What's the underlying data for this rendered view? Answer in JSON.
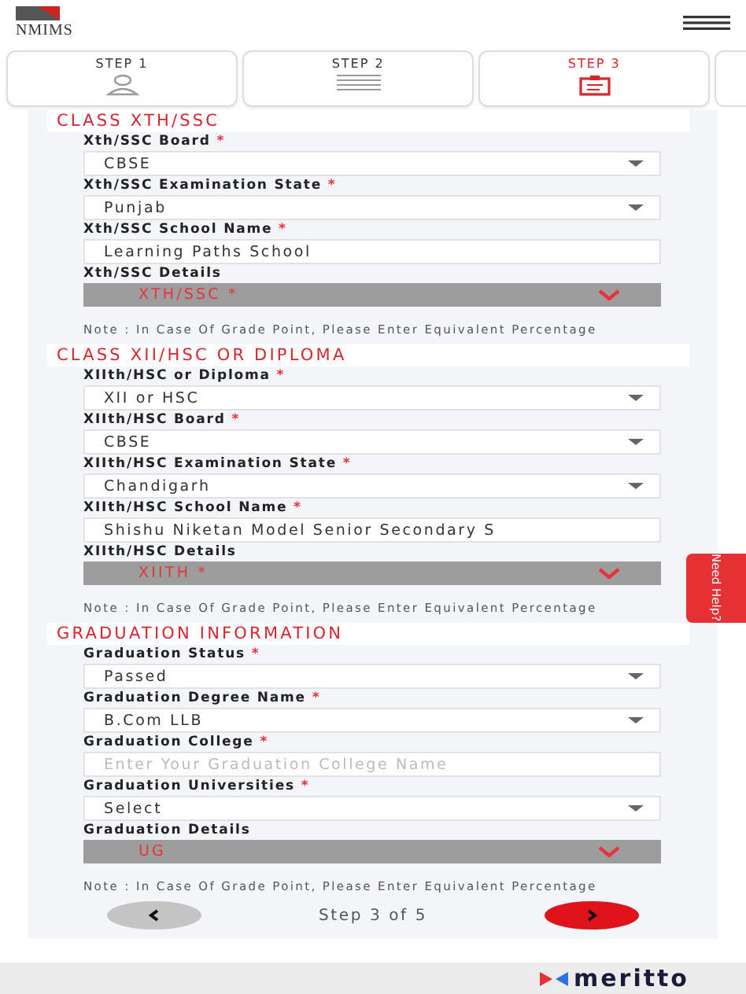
{
  "header": {
    "logo": "NMIMS"
  },
  "steps": [
    {
      "label": "STEP 1",
      "kind": "person",
      "selected": false
    },
    {
      "label": "STEP 2",
      "kind": "lines",
      "selected": false
    },
    {
      "label": "STEP 3",
      "kind": "form",
      "selected": true
    }
  ],
  "sections": [
    {
      "title": "CLASS XTH/SSC",
      "fields": [
        {
          "label": "Xth/SSC Board",
          "mark": "*",
          "kind": "select",
          "value": "CBSE"
        },
        {
          "label": "Xth/SSC Examination State",
          "mark": "*",
          "kind": "select",
          "value": "Punjab"
        },
        {
          "label": "Xth/SSC School Name",
          "mark": "*",
          "kind": "text",
          "value": "Learning Paths School"
        }
      ],
      "details": {
        "label": "Xth/SSC Details",
        "value": "XTH/SSC *"
      },
      "note": "Note : In Case Of Grade Point, Please Enter Equivalent Percentage"
    },
    {
      "title": "CLASS XII/HSC OR DIPLOMA",
      "fields": [
        {
          "label": "XIIth/HSC or Diploma",
          "mark": "*",
          "kind": "select",
          "value": "XII or HSC"
        },
        {
          "label": "XIIth/HSC Board",
          "mark": "*",
          "kind": "select",
          "value": "CBSE"
        },
        {
          "label": "XIIth/HSC Examination State",
          "mark": "*",
          "kind": "select",
          "value": "Chandigarh"
        },
        {
          "label": "XIIth/HSC School Name",
          "mark": "*",
          "kind": "text",
          "value": "Shishu Niketan Model Senior Secondary S"
        }
      ],
      "details": {
        "label": "XIIth/HSC Details",
        "value": "XIITH *"
      },
      "note": "Note : In Case Of Grade Point, Please Enter Equivalent Percentage"
    },
    {
      "title": "GRADUATION INFORMATION",
      "fields": [
        {
          "label": "Graduation Status",
          "mark": "*",
          "kind": "select",
          "value": "Passed"
        },
        {
          "label": "Graduation Degree Name",
          "mark": "*",
          "kind": "select",
          "value": "B.Com LLB"
        },
        {
          "label": "Graduation College",
          "mark": "*",
          "kind": "text",
          "placeholder": "Enter Your Graduation College Name"
        },
        {
          "label": "Graduation Universities",
          "mark": "*",
          "kind": "select",
          "value": "Select"
        }
      ],
      "details": {
        "label": "Graduation Details",
        "value": "UG"
      },
      "note": "Note : In Case Of Grade Point, Please Enter Equivalent Percentage"
    }
  ],
  "pager": {
    "text": "Step 3 of 5"
  },
  "help": {
    "label": "Need Help?"
  },
  "footer": {
    "brand": "meritto"
  }
}
